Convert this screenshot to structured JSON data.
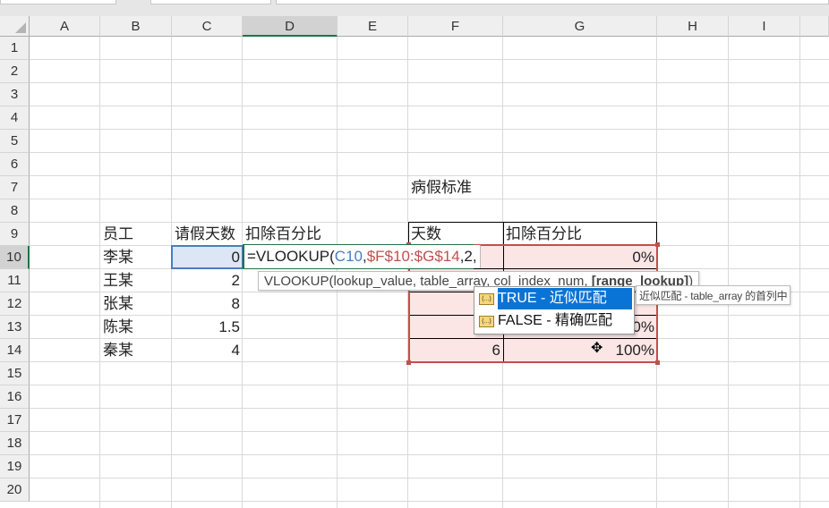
{
  "columns": [
    "A",
    "B",
    "C",
    "D",
    "E",
    "F",
    "G",
    "H",
    "I"
  ],
  "rows": [
    "1",
    "2",
    "3",
    "4",
    "5",
    "6",
    "7",
    "8",
    "9",
    "10",
    "11",
    "12",
    "13",
    "14",
    "15",
    "16",
    "17",
    "18",
    "19",
    "20"
  ],
  "cells": {
    "F7": "病假标准",
    "B9": "员工",
    "C9": "请假天数",
    "D9": "扣除百分比",
    "F9": "天数",
    "G9": "扣除百分比",
    "B10": "李某",
    "C10": "0",
    "G10": "0%",
    "B11": "王某",
    "C11": "2",
    "B12": "张某",
    "C12": "8",
    "B13": "陈某",
    "C13": "1.5",
    "G13": "0%",
    "B14": "秦某",
    "C14": "4",
    "F14": "6",
    "G14": "100%"
  },
  "formula": {
    "prefix": "=VLOOKUP(",
    "ref1": "C10",
    "sep1": ",",
    "ref2": "$F$10:$G$14",
    "rest": ",2,"
  },
  "signature_tip": {
    "text": "VLOOKUP(lookup_value, table_array, col_index_num, ",
    "bold": "[range_lookup]",
    "close": ")"
  },
  "autocomplete": [
    {
      "label": "TRUE - 近似匹配",
      "selected": true
    },
    {
      "label": "FALSE - 精确匹配",
      "selected": false
    }
  ],
  "description_tip": "近似匹配 - table_array 的首列中",
  "colors": {
    "ref1": "#4a7ebb",
    "ref2": "#c0504d",
    "accent": "#217346"
  }
}
